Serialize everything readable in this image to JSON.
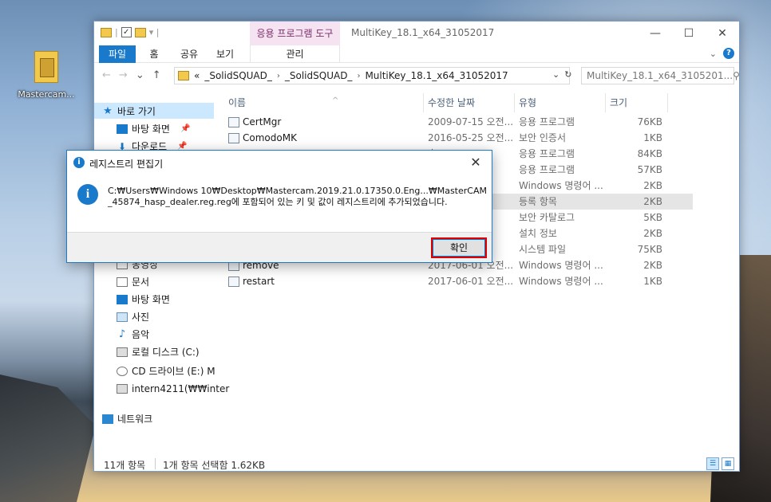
{
  "desktop": {
    "icon_label": "Mastercam..."
  },
  "explorer": {
    "app_tools_tab": "응용 프로그램 도구",
    "title": "MultiKey_18.1_x64_31052017",
    "window_buttons": {
      "minimize": "—",
      "maximize": "☐",
      "close": "✕"
    },
    "tabs": {
      "file": "파일",
      "home": "홈",
      "share": "공유",
      "view": "보기",
      "manage": "관리"
    },
    "address": {
      "prefix": "«",
      "crumbs": [
        "_SolidSQUAD_",
        "_SolidSQUAD_",
        "MultiKey_18.1_x64_31052017"
      ]
    },
    "search_placeholder": "MultiKey_18.1_x64_3105201...",
    "nav": {
      "quick_access": "바로 가기",
      "desktop_pinned": "바탕 화면",
      "downloads": "다운로드",
      "videos": "동영상",
      "documents": "문서",
      "desktop": "바탕 화면",
      "pictures": "사진",
      "music": "음악",
      "local_disk": "로컬 디스크 (C:)",
      "cd_drive": "CD 드라이브 (E:) M",
      "network_drive": "intern4211(₩₩inter",
      "network": "네트워크"
    },
    "columns": {
      "name": "이름",
      "date": "수정한 날짜",
      "type": "유형",
      "size": "크기"
    },
    "files": [
      {
        "name": "CertMgr",
        "date": "2009-07-15 오전...",
        "type": "응용 프로그램",
        "size": "76KB"
      },
      {
        "name": "ComodoMK",
        "date": "2016-05-25 오전...",
        "type": "보안 인증서",
        "size": "1KB"
      },
      {
        "name": "",
        "date": "후...",
        "type": "응용 프로그램",
        "size": "84KB"
      },
      {
        "name": "",
        "date": "후...",
        "type": "응용 프로그램",
        "size": "57KB"
      },
      {
        "name": "",
        "date": "전...",
        "type": "Windows 명령어 ...",
        "size": "2KB"
      },
      {
        "name": "",
        "date": "후...",
        "type": "등록 항목",
        "size": "2KB"
      },
      {
        "name": "",
        "date": "전...",
        "type": "보안 카탈로그",
        "size": "5KB"
      },
      {
        "name": "",
        "date": "전...",
        "type": "설치 정보",
        "size": "2KB"
      },
      {
        "name": "",
        "date": "후...",
        "type": "시스템 파일",
        "size": "75KB"
      },
      {
        "name": "remove",
        "date": "2017-06-01 오전...",
        "type": "Windows 명령어 ...",
        "size": "2KB"
      },
      {
        "name": "restart",
        "date": "2017-06-01 오전...",
        "type": "Windows 명령어 ...",
        "size": "1KB"
      }
    ],
    "status": {
      "count": "11개 항목",
      "selection": "1개 항목 선택함 1.62KB"
    }
  },
  "dialog": {
    "title": "레지스트리 편집기",
    "message": "C:₩Users₩Windows 10₩Desktop₩Mastercam.2019.21.0.17350.0.Eng...₩MasterCAM_45874_hasp_dealer.reg.reg에 포함되어 있는 키 및 값이 레지스트리에 추가되었습니다.",
    "ok_label": "확인",
    "close_glyph": "✕"
  }
}
